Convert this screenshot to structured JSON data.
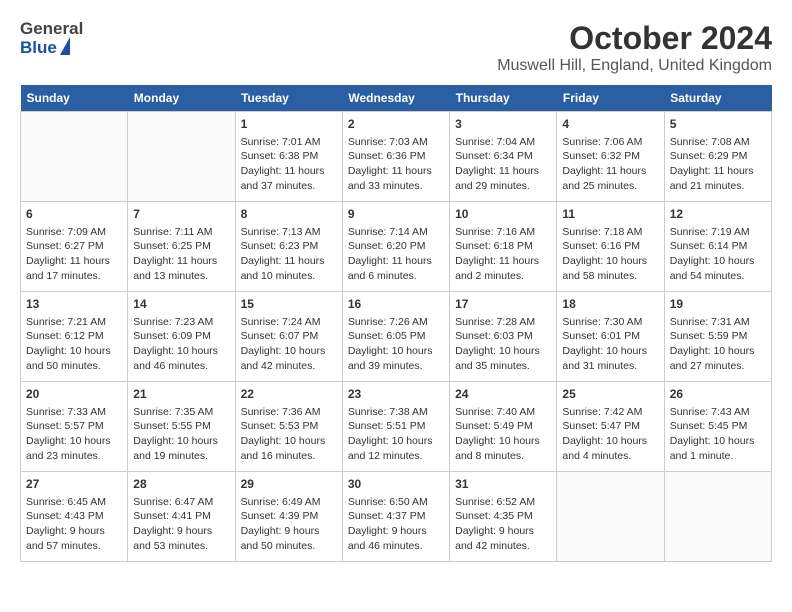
{
  "logo": {
    "general": "General",
    "blue": "Blue"
  },
  "title": "October 2024",
  "subtitle": "Muswell Hill, England, United Kingdom",
  "days_of_week": [
    "Sunday",
    "Monday",
    "Tuesday",
    "Wednesday",
    "Thursday",
    "Friday",
    "Saturday"
  ],
  "weeks": [
    [
      {
        "num": "",
        "info": ""
      },
      {
        "num": "",
        "info": ""
      },
      {
        "num": "1",
        "info": "Sunrise: 7:01 AM\nSunset: 6:38 PM\nDaylight: 11 hours and 37 minutes."
      },
      {
        "num": "2",
        "info": "Sunrise: 7:03 AM\nSunset: 6:36 PM\nDaylight: 11 hours and 33 minutes."
      },
      {
        "num": "3",
        "info": "Sunrise: 7:04 AM\nSunset: 6:34 PM\nDaylight: 11 hours and 29 minutes."
      },
      {
        "num": "4",
        "info": "Sunrise: 7:06 AM\nSunset: 6:32 PM\nDaylight: 11 hours and 25 minutes."
      },
      {
        "num": "5",
        "info": "Sunrise: 7:08 AM\nSunset: 6:29 PM\nDaylight: 11 hours and 21 minutes."
      }
    ],
    [
      {
        "num": "6",
        "info": "Sunrise: 7:09 AM\nSunset: 6:27 PM\nDaylight: 11 hours and 17 minutes."
      },
      {
        "num": "7",
        "info": "Sunrise: 7:11 AM\nSunset: 6:25 PM\nDaylight: 11 hours and 13 minutes."
      },
      {
        "num": "8",
        "info": "Sunrise: 7:13 AM\nSunset: 6:23 PM\nDaylight: 11 hours and 10 minutes."
      },
      {
        "num": "9",
        "info": "Sunrise: 7:14 AM\nSunset: 6:20 PM\nDaylight: 11 hours and 6 minutes."
      },
      {
        "num": "10",
        "info": "Sunrise: 7:16 AM\nSunset: 6:18 PM\nDaylight: 11 hours and 2 minutes."
      },
      {
        "num": "11",
        "info": "Sunrise: 7:18 AM\nSunset: 6:16 PM\nDaylight: 10 hours and 58 minutes."
      },
      {
        "num": "12",
        "info": "Sunrise: 7:19 AM\nSunset: 6:14 PM\nDaylight: 10 hours and 54 minutes."
      }
    ],
    [
      {
        "num": "13",
        "info": "Sunrise: 7:21 AM\nSunset: 6:12 PM\nDaylight: 10 hours and 50 minutes."
      },
      {
        "num": "14",
        "info": "Sunrise: 7:23 AM\nSunset: 6:09 PM\nDaylight: 10 hours and 46 minutes."
      },
      {
        "num": "15",
        "info": "Sunrise: 7:24 AM\nSunset: 6:07 PM\nDaylight: 10 hours and 42 minutes."
      },
      {
        "num": "16",
        "info": "Sunrise: 7:26 AM\nSunset: 6:05 PM\nDaylight: 10 hours and 39 minutes."
      },
      {
        "num": "17",
        "info": "Sunrise: 7:28 AM\nSunset: 6:03 PM\nDaylight: 10 hours and 35 minutes."
      },
      {
        "num": "18",
        "info": "Sunrise: 7:30 AM\nSunset: 6:01 PM\nDaylight: 10 hours and 31 minutes."
      },
      {
        "num": "19",
        "info": "Sunrise: 7:31 AM\nSunset: 5:59 PM\nDaylight: 10 hours and 27 minutes."
      }
    ],
    [
      {
        "num": "20",
        "info": "Sunrise: 7:33 AM\nSunset: 5:57 PM\nDaylight: 10 hours and 23 minutes."
      },
      {
        "num": "21",
        "info": "Sunrise: 7:35 AM\nSunset: 5:55 PM\nDaylight: 10 hours and 19 minutes."
      },
      {
        "num": "22",
        "info": "Sunrise: 7:36 AM\nSunset: 5:53 PM\nDaylight: 10 hours and 16 minutes."
      },
      {
        "num": "23",
        "info": "Sunrise: 7:38 AM\nSunset: 5:51 PM\nDaylight: 10 hours and 12 minutes."
      },
      {
        "num": "24",
        "info": "Sunrise: 7:40 AM\nSunset: 5:49 PM\nDaylight: 10 hours and 8 minutes."
      },
      {
        "num": "25",
        "info": "Sunrise: 7:42 AM\nSunset: 5:47 PM\nDaylight: 10 hours and 4 minutes."
      },
      {
        "num": "26",
        "info": "Sunrise: 7:43 AM\nSunset: 5:45 PM\nDaylight: 10 hours and 1 minute."
      }
    ],
    [
      {
        "num": "27",
        "info": "Sunrise: 6:45 AM\nSunset: 4:43 PM\nDaylight: 9 hours and 57 minutes."
      },
      {
        "num": "28",
        "info": "Sunrise: 6:47 AM\nSunset: 4:41 PM\nDaylight: 9 hours and 53 minutes."
      },
      {
        "num": "29",
        "info": "Sunrise: 6:49 AM\nSunset: 4:39 PM\nDaylight: 9 hours and 50 minutes."
      },
      {
        "num": "30",
        "info": "Sunrise: 6:50 AM\nSunset: 4:37 PM\nDaylight: 9 hours and 46 minutes."
      },
      {
        "num": "31",
        "info": "Sunrise: 6:52 AM\nSunset: 4:35 PM\nDaylight: 9 hours and 42 minutes."
      },
      {
        "num": "",
        "info": ""
      },
      {
        "num": "",
        "info": ""
      }
    ]
  ]
}
